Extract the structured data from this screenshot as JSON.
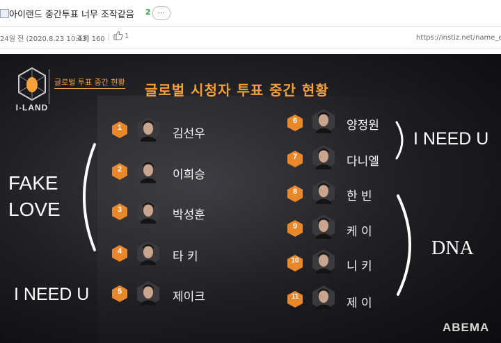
{
  "post": {
    "title": "아이랜드 중간투표 너무 조작같음",
    "comment_count": "2",
    "more_label": "···",
    "date": "24일 전 (2020.8.23 10:43)",
    "views": "조회 160",
    "likes": "1",
    "source": "https://instiz.net/name_ente"
  },
  "broadcast": {
    "logo_text": "I-LAND",
    "small_title": "글로벌 투표 중간 현황",
    "main_title": "글로벌 시청자 투표 중간 현황",
    "ranking": [
      {
        "rank": "1",
        "name": "김선우"
      },
      {
        "rank": "2",
        "name": "이희승"
      },
      {
        "rank": "3",
        "name": "박성훈"
      },
      {
        "rank": "4",
        "name": "타 키"
      },
      {
        "rank": "5",
        "name": "제이크"
      },
      {
        "rank": "6",
        "name": "양정원"
      },
      {
        "rank": "7",
        "name": "다니엘"
      },
      {
        "rank": "8",
        "name": "한 빈"
      },
      {
        "rank": "9",
        "name": "케 이"
      },
      {
        "rank": "10",
        "name": "니 키"
      },
      {
        "rank": "11",
        "name": "제 이"
      }
    ],
    "song_labels": {
      "fake_love_line1": "FAKE",
      "fake_love_line2": "LOVE",
      "i_need_u_left": "I NEED U",
      "i_need_u_right": "I NEED U",
      "dna": "DNA"
    },
    "watermark": "ABEMA",
    "colors": {
      "accent_orange": "#f5a03a",
      "badge_orange": "#e8882a"
    }
  }
}
